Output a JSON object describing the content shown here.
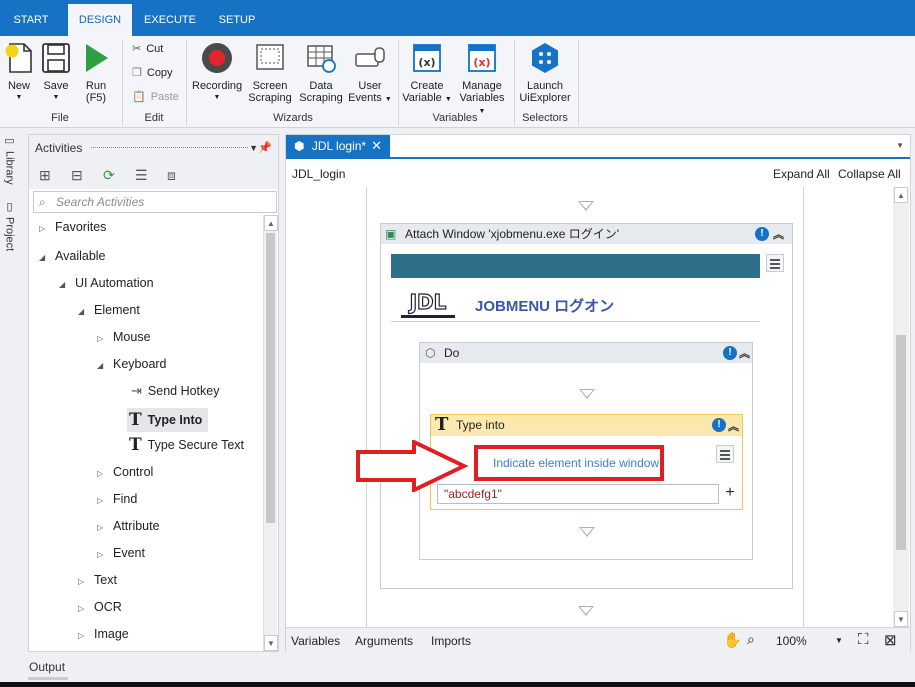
{
  "tabs": [
    {
      "label": "START"
    },
    {
      "label": "DESIGN"
    },
    {
      "label": "EXECUTE"
    },
    {
      "label": "SETUP"
    }
  ],
  "ribbon": {
    "new": "New",
    "save": "Save",
    "run": "Run",
    "run_sub": "(F5)",
    "cut": "Cut",
    "copy": "Copy",
    "paste": "Paste",
    "recording": "Recording",
    "screen_scraping_1": "Screen",
    "screen_scraping_2": "Scraping",
    "data_scraping_1": "Data",
    "data_scraping_2": "Scraping",
    "user_events_1": "User",
    "user_events_2": "Events",
    "create_variable_1": "Create",
    "create_variable_2": "Variable",
    "manage_variables_1": "Manage",
    "manage_variables_2": "Variables",
    "launch_1": "Launch",
    "launch_2": "UiExplorer",
    "groups": {
      "file": "File",
      "edit": "Edit",
      "wizards": "Wizards",
      "variables": "Variables",
      "selectors": "Selectors"
    }
  },
  "side": {
    "library": "Library",
    "project": "Project"
  },
  "activities": {
    "title": "Activities",
    "search_placeholder": "Search Activities",
    "tree": {
      "favorites": "Favorites",
      "available": "Available",
      "ui_automation": "UI Automation",
      "element": "Element",
      "mouse": "Mouse",
      "keyboard": "Keyboard",
      "send_hotkey": "Send Hotkey",
      "type_into": "Type Into",
      "type_secure_text": "Type Secure Text",
      "control": "Control",
      "find": "Find",
      "attribute": "Attribute",
      "event": "Event",
      "text": "Text",
      "ocr": "OCR",
      "image": "Image"
    }
  },
  "designer": {
    "tab_title": "JDL login*",
    "breadcrumb": "JDL_login",
    "expand_all": "Expand All",
    "collapse_all": "Collapse All",
    "attach_title": "Attach Window 'xjobmenu.exe  ログイン'",
    "app_title": "JOBMENU ログオン",
    "logo_text": "JDL",
    "do_title": "Do",
    "type_into_title": "Type into",
    "indicate": "Indicate element inside window",
    "text_value": "\"abcdefg1\""
  },
  "bottom": {
    "variables": "Variables",
    "arguments": "Arguments",
    "imports": "Imports",
    "zoom": "100%"
  },
  "output": "Output",
  "colors": {
    "brand_blue": "#1572c4",
    "highlight_red": "#e02020",
    "type_into_header": "#fbe8ae"
  }
}
